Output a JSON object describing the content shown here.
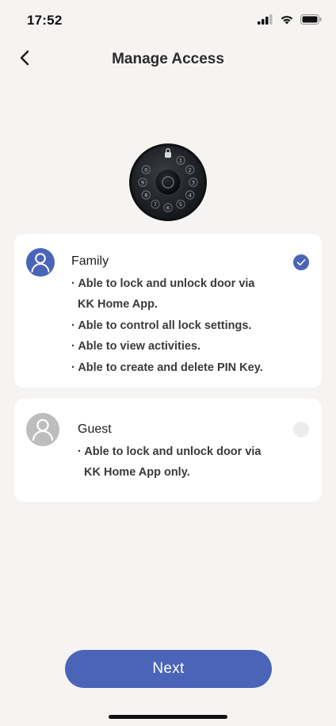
{
  "status_bar": {
    "time": "17:52",
    "icons": [
      "cellular-signal-icon",
      "wifi-icon",
      "battery-icon"
    ]
  },
  "header": {
    "title": "Manage Access",
    "back_icon": "chevron-left-icon"
  },
  "lock": {
    "keys": [
      "0",
      "1",
      "2",
      "3",
      "4",
      "5",
      "6",
      "7",
      "8",
      "9"
    ]
  },
  "roles": [
    {
      "name": "Family",
      "selected": true,
      "permissions": [
        "· Able to lock and unlock door via",
        "KK Home App.",
        "· Able to control all lock settings.",
        "· Able to view activities.",
        "· Able to create and delete PIN Key."
      ]
    },
    {
      "name": "Guest",
      "selected": false,
      "permissions": [
        "· Able to lock and unlock door via",
        "KK Home App only."
      ]
    }
  ],
  "footer": {
    "next_label": "Next"
  },
  "colors": {
    "accent": "#4a64b8",
    "background": "#f5f4f2",
    "card": "#ffffff",
    "inactive_avatar": "#bdbdbd",
    "radio_unselected": "#ececec"
  }
}
